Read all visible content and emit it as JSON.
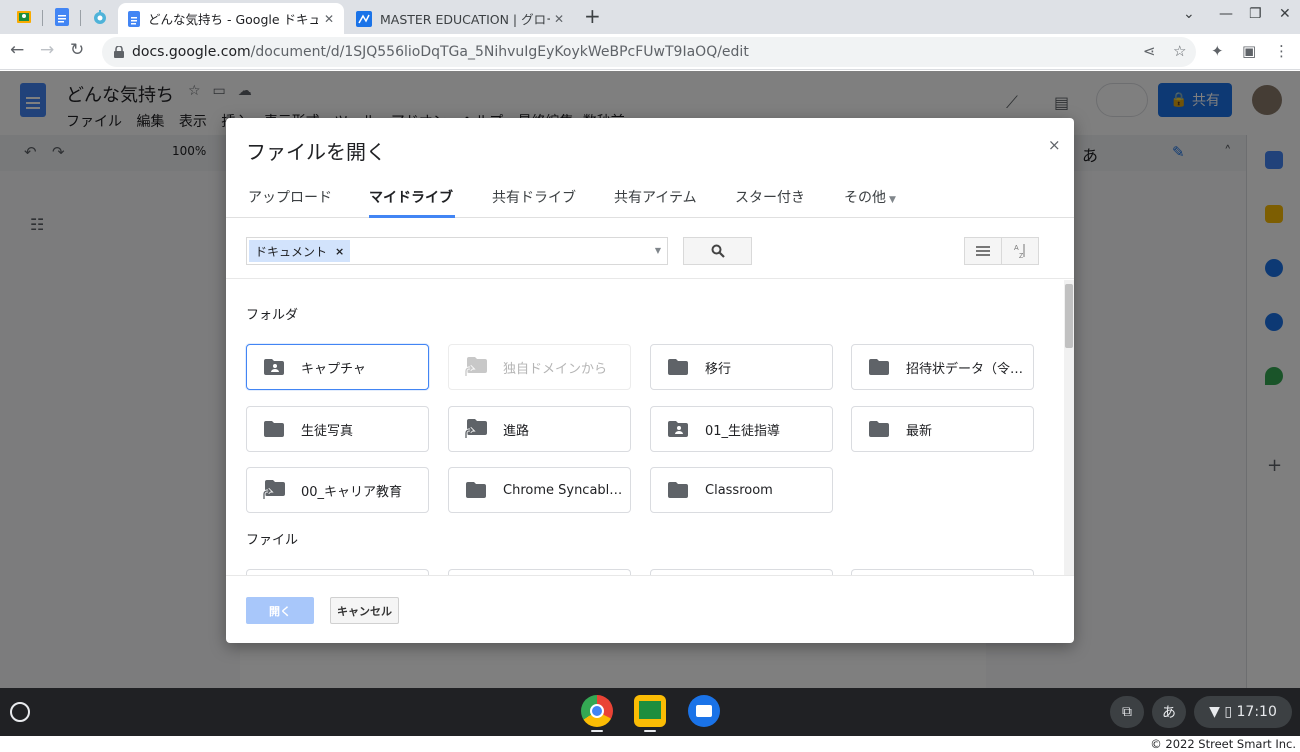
{
  "browser": {
    "tabs": [
      {
        "title": "どんな気持ち - Google ドキュメ",
        "active": true
      },
      {
        "title": "MASTER EDUCATION | グロー",
        "active": false
      }
    ],
    "url_host": "docs.google.com",
    "url_path": "/document/d/1SJQ556lioDqTGa_5NihvuIgEyKoykWeBPcFUwT9IaOQ/edit"
  },
  "docs": {
    "title": "どんな気持ち",
    "menu": [
      "ファイル",
      "編集",
      "表示",
      "挿入",
      "表示形式",
      "ツール",
      "アドオン",
      "ヘルプ",
      "最終編集: 数秒前"
    ],
    "share_label": "共有",
    "zoom": "100%",
    "input_mode": "あ"
  },
  "dialog": {
    "title": "ファイルを開く",
    "close_label": "×",
    "tabs": [
      "アップロード",
      "マイドライブ",
      "共有ドライブ",
      "共有アイテム",
      "スター付き",
      "その他"
    ],
    "active_tab": "マイドライブ",
    "filter_chip": "ドキュメント",
    "sections": {
      "folders": "フォルダ",
      "files": "ファイル"
    },
    "folders": [
      {
        "name": "キャプチャ",
        "icon": "shared-folder-icon",
        "state": "selected"
      },
      {
        "name": "独自ドメインから",
        "icon": "shortcut-folder-icon",
        "state": "disabled"
      },
      {
        "name": "移行",
        "icon": "folder-icon",
        "state": "normal"
      },
      {
        "name": "招待状データ（令…",
        "icon": "folder-icon",
        "state": "normal"
      },
      {
        "name": "生徒写真",
        "icon": "folder-icon",
        "state": "normal"
      },
      {
        "name": "進路",
        "icon": "shortcut-folder-icon",
        "state": "normal"
      },
      {
        "name": "01_生徒指導",
        "icon": "shared-folder-icon",
        "state": "normal"
      },
      {
        "name": "最新",
        "icon": "folder-icon",
        "state": "normal"
      },
      {
        "name": "00_キャリア教育",
        "icon": "shortcut-folder-icon",
        "state": "normal"
      },
      {
        "name": "Chrome Syncable F...",
        "icon": "folder-icon",
        "state": "normal"
      },
      {
        "name": "Classroom",
        "icon": "folder-icon",
        "state": "normal"
      }
    ],
    "open_label": "開く",
    "cancel_label": "キャンセル"
  },
  "shelf": {
    "ime": "あ",
    "time": "17:10"
  },
  "credit": "© 2022 Street Smart Inc."
}
